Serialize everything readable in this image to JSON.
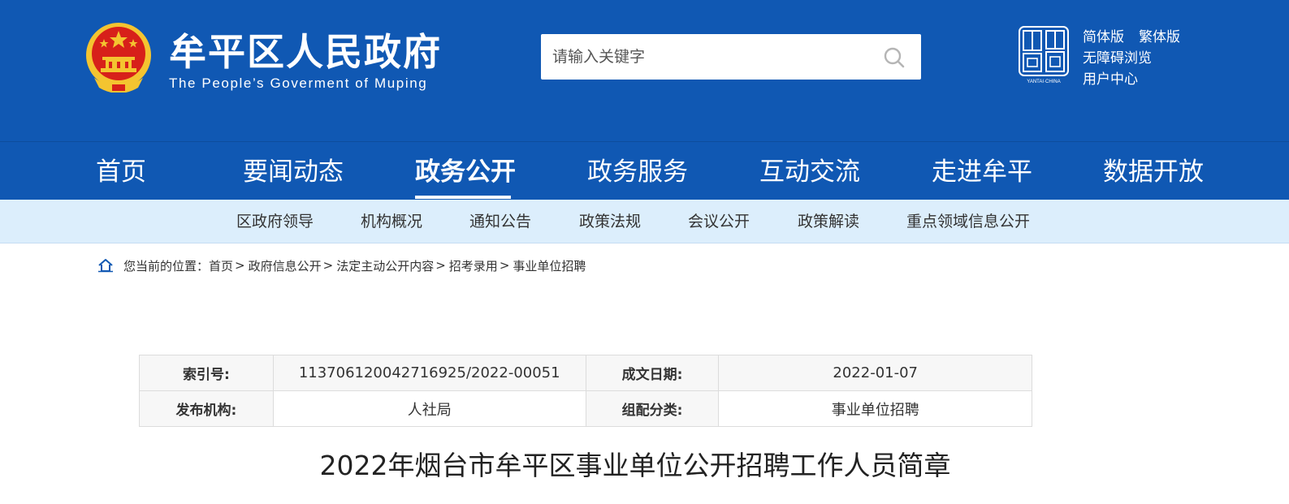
{
  "header": {
    "site_title": "牟平区人民政府",
    "site_subtitle": "The People’s Goverment of Muping",
    "search_placeholder": "请输入关键字",
    "links": {
      "simplified": "简体版",
      "traditional": "繁体版",
      "accessibility": "无障碍浏览",
      "user_center": "用户中心"
    },
    "logo_text": "YANTAI·CHINA",
    "colors": {
      "brand_blue": "#1058b3",
      "subnav_bg": "#dceefc",
      "emblem_red": "#d7201a",
      "emblem_gold": "#f4c430"
    }
  },
  "main_nav": {
    "items": [
      {
        "label": "首页",
        "active": false
      },
      {
        "label": "要闻动态",
        "active": false
      },
      {
        "label": "政务公开",
        "active": true
      },
      {
        "label": "政务服务",
        "active": false
      },
      {
        "label": "互动交流",
        "active": false
      },
      {
        "label": "走进牟平",
        "active": false
      },
      {
        "label": "数据开放",
        "active": false
      }
    ]
  },
  "sub_nav": {
    "items": [
      {
        "label": "区政府领导"
      },
      {
        "label": "机构概况"
      },
      {
        "label": "通知公告"
      },
      {
        "label": "政策法规"
      },
      {
        "label": "会议公开"
      },
      {
        "label": "政策解读"
      },
      {
        "label": "重点领域信息公开"
      }
    ]
  },
  "breadcrumb": {
    "prefix": "您当前的位置：",
    "items": [
      {
        "label": "首页"
      },
      {
        "label": "政府信息公开"
      },
      {
        "label": "法定主动公开内容"
      },
      {
        "label": "招考录用"
      },
      {
        "label": "事业单位招聘"
      }
    ],
    "separator": ">"
  },
  "info_table": {
    "index_label": "索引号:",
    "index_value": "113706120042716925/2022-00051",
    "date_label": "成文日期:",
    "date_value": "2022-01-07",
    "publisher_label": "发布机构:",
    "publisher_value": "人社局",
    "category_label": "组配分类:",
    "category_value": "事业单位招聘"
  },
  "article": {
    "title": "2022年烟台市牟平区事业单位公开招聘工作人员简章"
  }
}
